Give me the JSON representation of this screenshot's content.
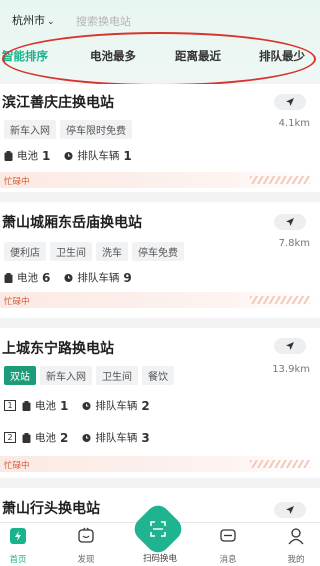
{
  "header": {
    "city": "杭州市",
    "search_placeholder": "搜索换电站"
  },
  "tabs": [
    {
      "label": "智能排序",
      "active": true
    },
    {
      "label": "电池最多",
      "active": false
    },
    {
      "label": "距离最近",
      "active": false
    },
    {
      "label": "排队最少",
      "active": false
    }
  ],
  "stations": [
    {
      "name": "滨江善庆庄换电站",
      "distance": "4.1km",
      "tags": [
        "新车入网",
        "停车限时免费"
      ],
      "battery_label": "电池",
      "battery": "1",
      "queue_label": "排队车辆",
      "queue": "1",
      "status": "忙碌中"
    },
    {
      "name": "萧山城厢东岳庙换电站",
      "distance": "7.8km",
      "tags": [
        "便利店",
        "卫生间",
        "洗车",
        "停车免费"
      ],
      "battery_label": "电池",
      "battery": "6",
      "queue_label": "排队车辆",
      "queue": "9",
      "status": "忙碌中"
    },
    {
      "name": "上城东宁路换电站",
      "distance": "13.9km",
      "tags": [
        "双站",
        "新车入网",
        "卫生间",
        "餐饮"
      ],
      "rows": [
        {
          "index": "1",
          "battery_label": "电池",
          "battery": "1",
          "queue_label": "排队车辆",
          "queue": "2"
        },
        {
          "index": "2",
          "battery_label": "电池",
          "battery": "2",
          "queue_label": "排队车辆",
          "queue": "3"
        }
      ],
      "status": "忙碌中"
    },
    {
      "name": "萧山行头换电站"
    }
  ],
  "bottom_nav": {
    "home": "首页",
    "discover": "发现",
    "scan": "扫码换电",
    "message": "消息",
    "mine": "我的"
  },
  "colors": {
    "accent": "#19b38c",
    "busy": "#d8562e",
    "highlight_oval": "#d8342b"
  }
}
